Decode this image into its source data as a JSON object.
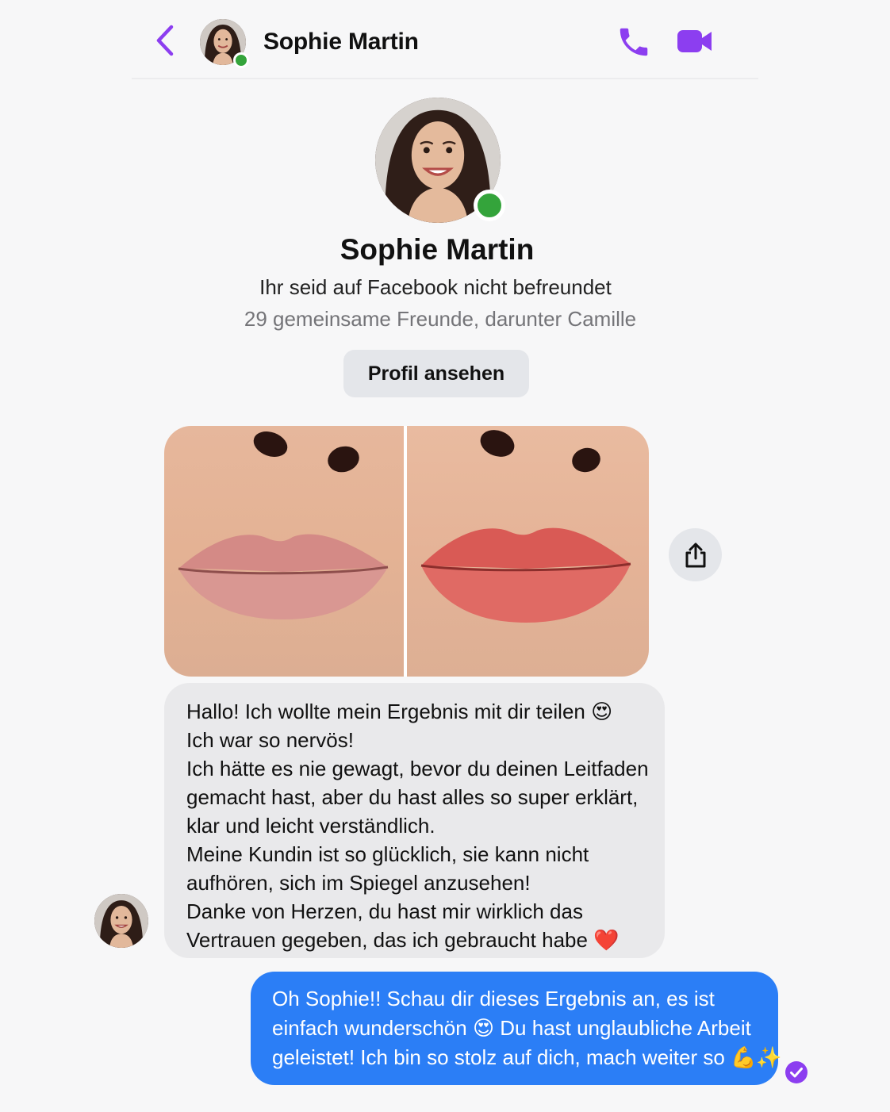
{
  "header": {
    "name": "Sophie Martin",
    "accent_color": "#8c3ef0",
    "back_icon": "chevron-left-icon",
    "call_icon": "phone-icon",
    "video_icon": "video-camera-icon"
  },
  "profile": {
    "name": "Sophie Martin",
    "relation": "Ihr seid auf Facebook nicht befreundet",
    "mutual_friends": "29 gemeinsame Freunde, darunter Camille",
    "view_profile_label": "Profil ansehen",
    "online_color": "#34a43b"
  },
  "thread": {
    "incoming_lines": [
      "Hallo! Ich wollte mein Ergebnis mit dir teilen 😍",
      "Ich war so nervös!",
      "Ich hätte es nie gewagt, bevor du deinen Leitfaden",
      "gemacht hast, aber du hast alles so super erklärt,",
      "klar und leicht verständlich.",
      "Meine Kundin ist so glücklich, sie kann nicht",
      "aufhören, sich im Spiegel anzusehen!",
      "Danke von Herzen, du hast mir wirklich das",
      "Vertrauen gegeben, das ich gebraucht habe ❤️"
    ],
    "outgoing_lines": [
      "Oh Sophie!! Schau dir dieses Ergebnis an, es ist",
      "einfach wunderschön 😍 Du hast unglaubliche Arbeit",
      "geleistet! Ich bin so stolz auf dich, mach weiter so 💪✨"
    ],
    "outgoing_color": "#2b7ef6",
    "incoming_color": "#e9e9eb",
    "share_icon": "share-icon",
    "seen_icon": "seen-check-icon"
  }
}
